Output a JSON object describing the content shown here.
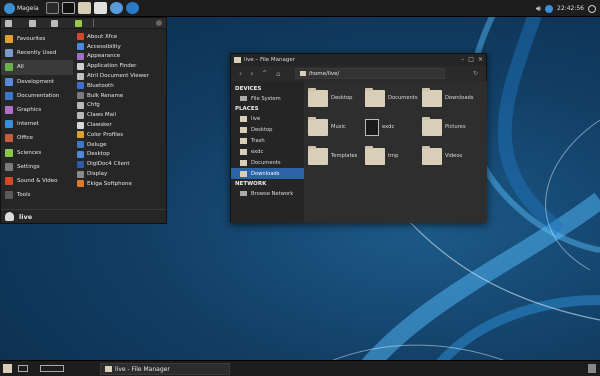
{
  "top_panel": {
    "menu_label": "Mageia",
    "clock": "22:42:56",
    "launchers": [
      "terminal",
      "file-manager",
      "text-editor",
      "browser",
      "web-browser-2",
      "updates"
    ]
  },
  "menu": {
    "categories": [
      {
        "label": "Favourites",
        "icon": "star-icon"
      },
      {
        "label": "Recently Used",
        "icon": "clock-icon"
      },
      {
        "label": "All",
        "icon": "grid-icon"
      },
      {
        "label": "Development",
        "icon": "development-icon"
      },
      {
        "label": "Documentation",
        "icon": "book-icon"
      },
      {
        "label": "Graphics",
        "icon": "graphics-icon"
      },
      {
        "label": "Internet",
        "icon": "globe-icon"
      },
      {
        "label": "Office",
        "icon": "office-icon"
      },
      {
        "label": "Sciences",
        "icon": "sciences-icon"
      },
      {
        "label": "Settings",
        "icon": "settings-icon"
      },
      {
        "label": "Sound & Video",
        "icon": "multimedia-icon"
      },
      {
        "label": "Tools",
        "icon": "tools-icon"
      }
    ],
    "apps": [
      {
        "label": "About Xfce",
        "color": "#d04a2a"
      },
      {
        "label": "Accessibility",
        "color": "#4a8ad8"
      },
      {
        "label": "Appearance",
        "color": "#9a70c8"
      },
      {
        "label": "Application Finder",
        "color": "#cfcfcf"
      },
      {
        "label": "Atril Document Viewer",
        "color": "#c0c0c0"
      },
      {
        "label": "Bluetooth",
        "color": "#3a6fcf"
      },
      {
        "label": "Bulk Rename",
        "color": "#7a7a7a"
      },
      {
        "label": "Chfg",
        "color": "#b8b8b8"
      },
      {
        "label": "Claws Mail",
        "color": "#b8b8b8"
      },
      {
        "label": "Clawsker",
        "color": "#d8d8d8"
      },
      {
        "label": "Color Profiles",
        "color": "#e0a030"
      },
      {
        "label": "Deluge",
        "color": "#3a78c8"
      },
      {
        "label": "Desktop",
        "color": "#4a8ad8"
      },
      {
        "label": "DigiDoc4 Client",
        "color": "#2a5aa8"
      },
      {
        "label": "Display",
        "color": "#8a8a8a"
      },
      {
        "label": "Ekiga Softphone",
        "color": "#e07a2a"
      }
    ],
    "user_name": "live"
  },
  "file_manager": {
    "title": "live – File Manager",
    "path": "/home/live/",
    "sidebar": {
      "devices_header": "DEVICES",
      "devices": [
        "File System"
      ],
      "places_header": "PLACES",
      "places": [
        "live",
        "Desktop",
        "Trash",
        "exdc",
        "Documents",
        "Downloads"
      ],
      "selected_place": "Downloads",
      "network_header": "NETWORK",
      "network": [
        "Browse Network"
      ]
    },
    "files": [
      {
        "name": "Desktop",
        "kind": "folder"
      },
      {
        "name": "Documents",
        "kind": "folder"
      },
      {
        "name": "Downloads",
        "kind": "folder"
      },
      {
        "name": "Music",
        "kind": "folder"
      },
      {
        "name": "exdc",
        "kind": "file"
      },
      {
        "name": "Pictures",
        "kind": "folder"
      },
      {
        "name": "Templates",
        "kind": "folder"
      },
      {
        "name": "tmp",
        "kind": "folder"
      },
      {
        "name": "Videos",
        "kind": "folder"
      }
    ]
  },
  "taskbar": {
    "items": [
      "live - File Manager"
    ]
  },
  "colors": {
    "accent": "#2b63a8",
    "panel": "#1d1d1d"
  }
}
